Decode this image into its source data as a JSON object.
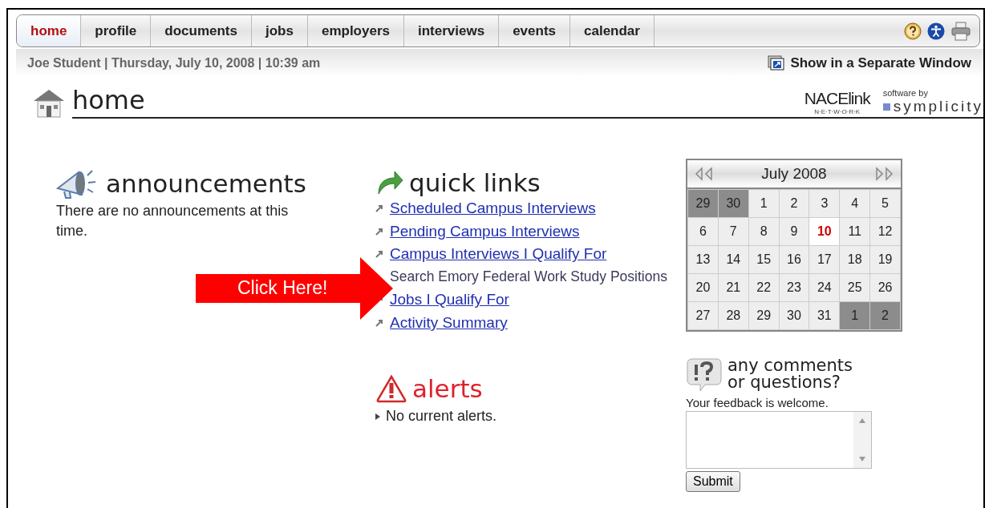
{
  "tabs": [
    {
      "label": "home",
      "selected": true
    },
    {
      "label": "profile",
      "selected": false
    },
    {
      "label": "documents",
      "selected": false
    },
    {
      "label": "jobs",
      "selected": false
    },
    {
      "label": "employers",
      "selected": false
    },
    {
      "label": "interviews",
      "selected": false
    },
    {
      "label": "events",
      "selected": false
    },
    {
      "label": "calendar",
      "selected": false
    }
  ],
  "info_bar": {
    "text": "Joe Student | Thursday, July 10, 2008 | 10:39 am",
    "separate_window": "Show in a Separate Window"
  },
  "header": {
    "title": "home",
    "logo_main": "NACElink",
    "logo_sub": "N·E·T·W·O·R·K",
    "software_by": "software by",
    "vendor": "symplicity"
  },
  "announcements": {
    "title": "announcements",
    "text": "There are no announcements at this time."
  },
  "quick_links": {
    "title": "quick links",
    "items": [
      {
        "label": "Scheduled Campus Interviews ",
        "kind": "link"
      },
      {
        "label": "Pending Campus Interviews",
        "kind": "link"
      },
      {
        "label": "Campus Interviews I Qualify For",
        "kind": "link"
      },
      {
        "label": "Search Emory Federal Work Study Positions",
        "kind": "text"
      },
      {
        "label": "Jobs I Qualify For",
        "kind": "link"
      },
      {
        "label": "Activity Summary",
        "kind": "link"
      }
    ]
  },
  "callout": {
    "label": "Click Here!"
  },
  "alerts": {
    "title": "alerts",
    "items": [
      "No current alerts."
    ]
  },
  "calendar": {
    "title": "July 2008",
    "days": [
      {
        "day": "29",
        "kind": "other"
      },
      {
        "day": "30",
        "kind": "other"
      },
      {
        "day": "1",
        "kind": "current"
      },
      {
        "day": "2",
        "kind": "current"
      },
      {
        "day": "3",
        "kind": "current"
      },
      {
        "day": "4",
        "kind": "current"
      },
      {
        "day": "5",
        "kind": "current"
      },
      {
        "day": "6",
        "kind": "current"
      },
      {
        "day": "7",
        "kind": "current"
      },
      {
        "day": "8",
        "kind": "current"
      },
      {
        "day": "9",
        "kind": "current"
      },
      {
        "day": "10",
        "kind": "today"
      },
      {
        "day": "11",
        "kind": "current"
      },
      {
        "day": "12",
        "kind": "current"
      },
      {
        "day": "13",
        "kind": "current"
      },
      {
        "day": "14",
        "kind": "current"
      },
      {
        "day": "15",
        "kind": "current"
      },
      {
        "day": "16",
        "kind": "current"
      },
      {
        "day": "17",
        "kind": "current"
      },
      {
        "day": "18",
        "kind": "current"
      },
      {
        "day": "19",
        "kind": "current"
      },
      {
        "day": "20",
        "kind": "current"
      },
      {
        "day": "21",
        "kind": "current"
      },
      {
        "day": "22",
        "kind": "current"
      },
      {
        "day": "23",
        "kind": "current"
      },
      {
        "day": "24",
        "kind": "current"
      },
      {
        "day": "25",
        "kind": "current"
      },
      {
        "day": "26",
        "kind": "current"
      },
      {
        "day": "27",
        "kind": "current"
      },
      {
        "day": "28",
        "kind": "current"
      },
      {
        "day": "29",
        "kind": "current"
      },
      {
        "day": "30",
        "kind": "current"
      },
      {
        "day": "31",
        "kind": "current"
      },
      {
        "day": "1",
        "kind": "other"
      },
      {
        "day": "2",
        "kind": "other"
      }
    ]
  },
  "feedback": {
    "title": "any comments or questions?",
    "prompt": "Your feedback is welcome.",
    "submit": "Submit"
  }
}
